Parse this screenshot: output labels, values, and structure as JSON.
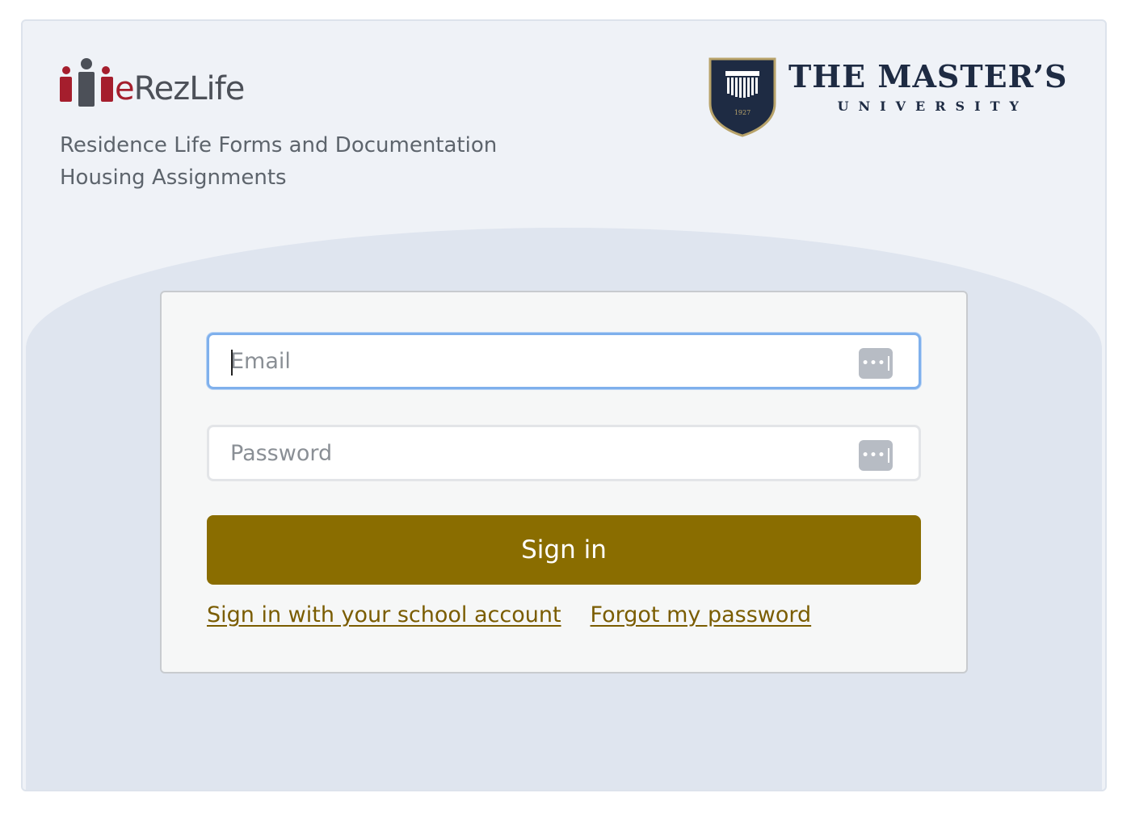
{
  "brand": {
    "logo_prefix": "e",
    "logo_rest": "RezLife",
    "tagline_lines": [
      "Residence Life Forms and Documentation",
      "Housing Assignments"
    ]
  },
  "university": {
    "name": "THE MASTER’S",
    "sub": "UNIVERSITY",
    "crest_year": "1927"
  },
  "login": {
    "email_placeholder": "Email",
    "password_placeholder": "Password",
    "signin_label": "Sign in",
    "school_account_link": "Sign in with your school account",
    "forgot_password_link": "Forgot my password"
  },
  "colors": {
    "brand_red": "#a51e2d",
    "brand_gray": "#4c5058",
    "button": "#8a6d00",
    "link": "#7a5c00",
    "focus": "#7fb0ec"
  },
  "icons": {
    "password_manager": "password-manager-icon",
    "people_logo": "people-logo-icon",
    "crest": "university-crest-icon"
  }
}
